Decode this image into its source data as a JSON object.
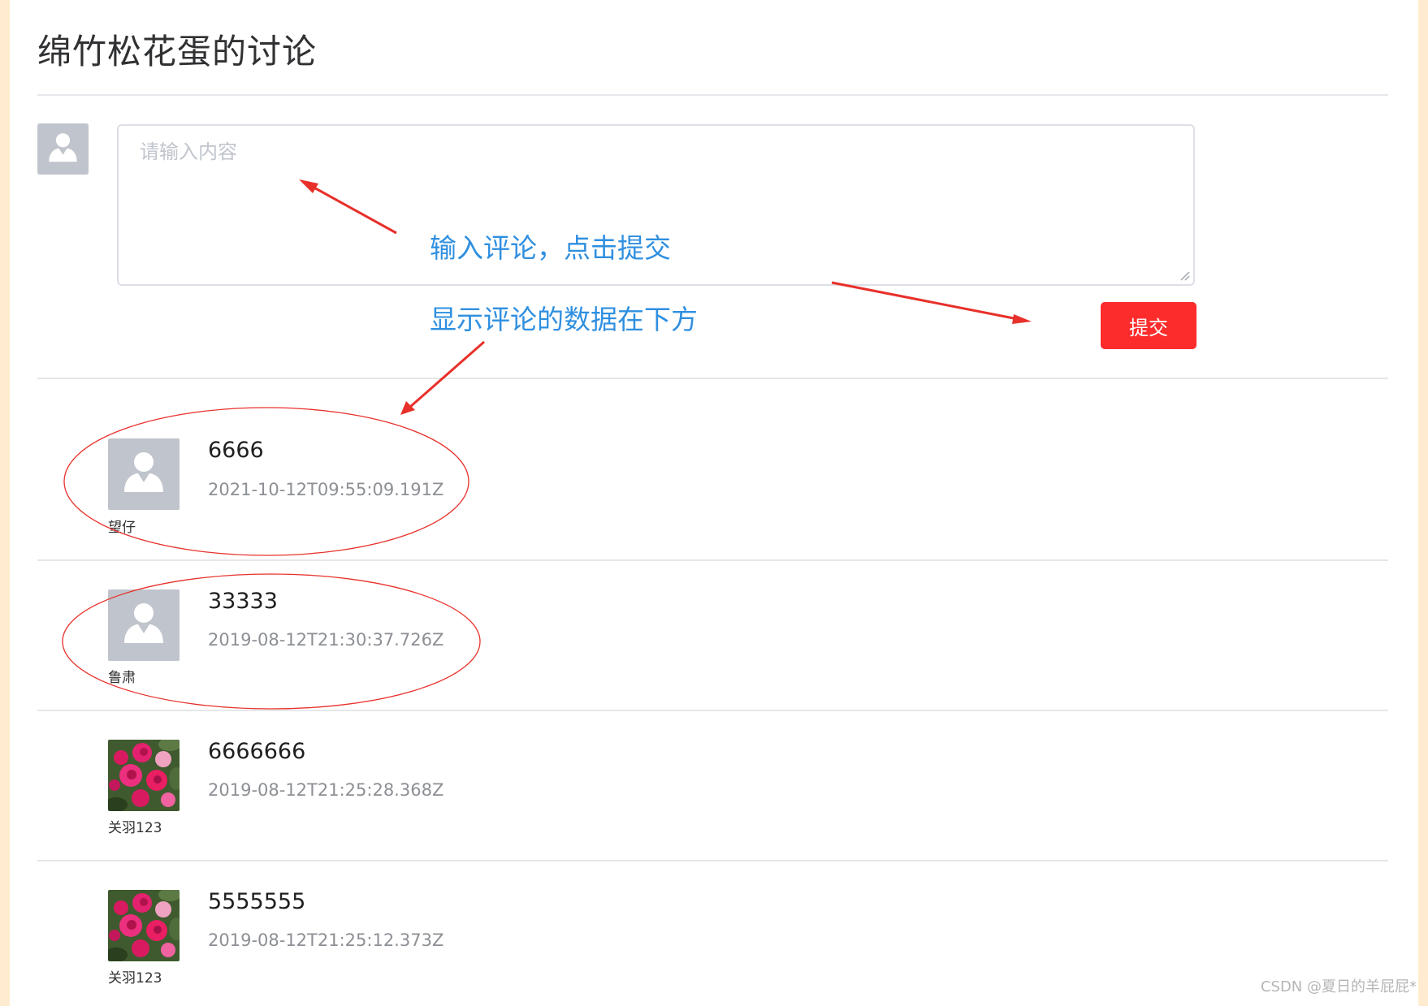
{
  "page": {
    "title": "绵竹松花蛋的讨论"
  },
  "editor": {
    "placeholder": "请输入内容",
    "submit_label": "提交"
  },
  "annotations": {
    "input_note": "输入评论，点击提交",
    "list_note": "显示评论的数据在下方",
    "color": "#e8302a",
    "note_color": "#2f8fe0"
  },
  "comments": [
    {
      "user": "望仔",
      "content": "6666",
      "time": "2021-10-12T09:55:09.191Z",
      "avatar": "default-user-icon"
    },
    {
      "user": "鲁肃",
      "content": "33333",
      "time": "2019-08-12T21:30:37.726Z",
      "avatar": "default-user-icon"
    },
    {
      "user": "关羽123",
      "content": "6666666",
      "time": "2019-08-12T21:25:28.368Z",
      "avatar": "rose-photo"
    },
    {
      "user": "关羽123",
      "content": "5555555",
      "time": "2019-08-12T21:25:12.373Z",
      "avatar": "rose-photo"
    }
  ],
  "watermark": "CSDN @夏日的羊屁屁*",
  "colors": {
    "submit_button": "#fc2c2c",
    "avatar_placeholder": "#c0c4cc",
    "page_border": "#ffecd0"
  }
}
